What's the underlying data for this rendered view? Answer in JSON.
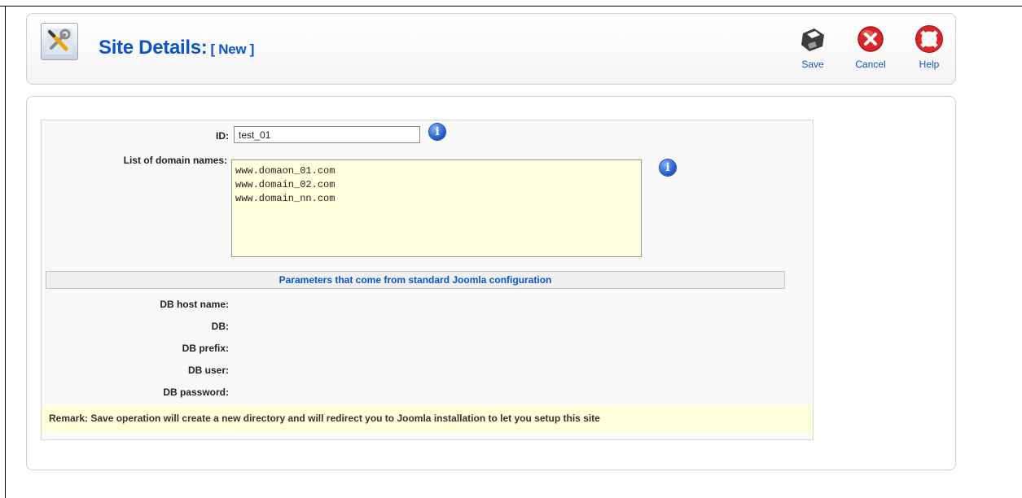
{
  "header": {
    "title": "Site Details:",
    "subtitle": "[ New ]",
    "icon": "tools-icon"
  },
  "toolbar": {
    "save_label": "Save",
    "cancel_label": "Cancel",
    "help_label": "Help"
  },
  "form": {
    "id_label": "ID:",
    "id_value": "test_01",
    "domains_label": "List of domain names:",
    "domains_value": "www.domaon_01.com\nwww.domain_02.com\nwww.domain_nn.com",
    "params_header": "Parameters that come from standard Joomla configuration",
    "db_host_label": "DB host name:",
    "db_label": "DB:",
    "db_prefix_label": "DB prefix:",
    "db_user_label": "DB user:",
    "db_password_label": "DB password:",
    "remark": "Remark: Save operation will create a new directory and will redirect you to Joomla installation to let you setup this site"
  },
  "colors": {
    "accent": "#0b55c4",
    "textarea_bg": "#ffffdd",
    "remark_bg": "#fefed9"
  }
}
